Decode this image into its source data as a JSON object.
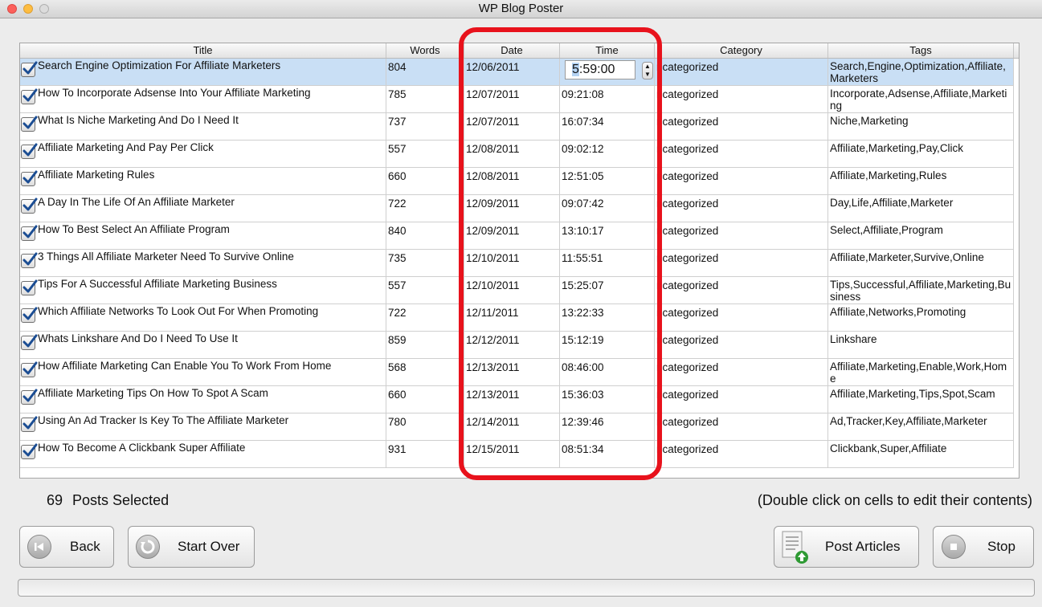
{
  "window": {
    "title": "WP Blog Poster"
  },
  "table": {
    "columns": [
      "Title",
      "Words",
      "Date",
      "Time",
      "Category",
      "Tags"
    ],
    "editing": {
      "time_selected_digit": "5",
      "time_rest": ":59:00"
    },
    "rows": [
      {
        "title": "Search Engine Optimization For Affiliate Marketers",
        "words": "804",
        "date": "12/06/2011",
        "time": "",
        "category": "ncategorized",
        "tags": "Search,Engine,Optimization,Affiliate,Marketers"
      },
      {
        "title": "How To Incorporate Adsense Into Your Affiliate Marketing",
        "words": "785",
        "date": "12/07/2011",
        "time": "09:21:08",
        "category": "ncategorized",
        "tags": "Incorporate,Adsense,Affiliate,Marketing"
      },
      {
        "title": "What Is Niche Marketing And Do I Need It",
        "words": "737",
        "date": "12/07/2011",
        "time": "16:07:34",
        "category": "ncategorized",
        "tags": "Niche,Marketing"
      },
      {
        "title": "Affiliate Marketing And Pay Per Click",
        "words": "557",
        "date": "12/08/2011",
        "time": "09:02:12",
        "category": "ncategorized",
        "tags": "Affiliate,Marketing,Pay,Click"
      },
      {
        "title": "Affiliate Marketing Rules",
        "words": "660",
        "date": "12/08/2011",
        "time": "12:51:05",
        "category": "ncategorized",
        "tags": "Affiliate,Marketing,Rules"
      },
      {
        "title": "A Day In The Life Of An Affiliate Marketer",
        "words": "722",
        "date": "12/09/2011",
        "time": "09:07:42",
        "category": "ncategorized",
        "tags": "Day,Life,Affiliate,Marketer"
      },
      {
        "title": "How To Best Select An Affiliate Program",
        "words": "840",
        "date": "12/09/2011",
        "time": "13:10:17",
        "category": "ncategorized",
        "tags": "Select,Affiliate,Program"
      },
      {
        "title": "3 Things All Affiliate Marketer Need To Survive Online",
        "words": "735",
        "date": "12/10/2011",
        "time": "11:55:51",
        "category": "ncategorized",
        "tags": "Affiliate,Marketer,Survive,Online"
      },
      {
        "title": "Tips For A Successful Affiliate Marketing Business",
        "words": "557",
        "date": "12/10/2011",
        "time": "15:25:07",
        "category": "ncategorized",
        "tags": "Tips,Successful,Affiliate,Marketing,Business"
      },
      {
        "title": "Which Affiliate Networks To Look Out For When Promoting",
        "words": "722",
        "date": "12/11/2011",
        "time": "13:22:33",
        "category": "ncategorized",
        "tags": "Affiliate,Networks,Promoting"
      },
      {
        "title": "Whats Linkshare And Do I Need To Use It",
        "words": "859",
        "date": "12/12/2011",
        "time": "15:12:19",
        "category": "ncategorized",
        "tags": "Linkshare"
      },
      {
        "title": "How Affiliate Marketing Can Enable You To Work From Home",
        "words": "568",
        "date": "12/13/2011",
        "time": "08:46:00",
        "category": "ncategorized",
        "tags": "Affiliate,Marketing,Enable,Work,Home"
      },
      {
        "title": "Affiliate Marketing Tips On How To Spot A Scam",
        "words": "660",
        "date": "12/13/2011",
        "time": "15:36:03",
        "category": "ncategorized",
        "tags": "Affiliate,Marketing,Tips,Spot,Scam"
      },
      {
        "title": "Using An Ad Tracker Is Key To The Affiliate Marketer",
        "words": "780",
        "date": "12/14/2011",
        "time": "12:39:46",
        "category": "ncategorized",
        "tags": "Ad,Tracker,Key,Affiliate,Marketer"
      },
      {
        "title": "How To Become A Clickbank Super Affiliate",
        "words": "931",
        "date": "12/15/2011",
        "time": "08:51:34",
        "category": "ncategorized",
        "tags": "Clickbank,Super,Affiliate"
      }
    ]
  },
  "status": {
    "count": "69",
    "selected_label": "Posts Selected",
    "hint": "(Double click on cells to edit their contents)"
  },
  "buttons": {
    "back": "Back",
    "start_over": "Start Over",
    "post_articles": "Post Articles",
    "stop": "Stop"
  },
  "colors": {
    "highlight": "#e8121c",
    "selected_row": "#c9dff5"
  }
}
